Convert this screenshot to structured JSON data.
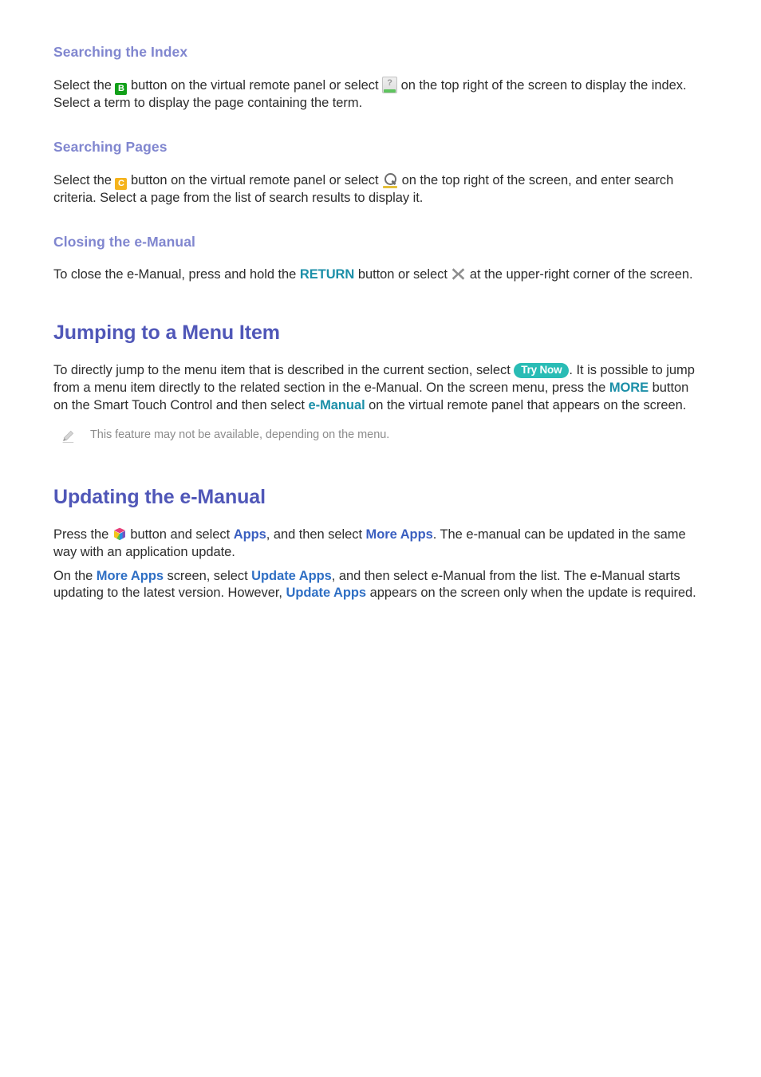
{
  "document": {
    "title": "e-Manual help page"
  },
  "sections": [
    {
      "id": "searching-the-index",
      "level": "h3",
      "heading": "Searching the Index",
      "paragraph_parts": [
        "Select the ",
        "[icon:color-button-b]",
        " button on the virtual remote panel or select ",
        "[icon:index]",
        " on the top right of the screen to display the index. Select a term to display the page containing the term."
      ],
      "text_1": "Select the ",
      "text_2": " button on the virtual remote panel or select ",
      "text_3": " on the top right of the screen to display the index. Select a term to display the page containing the term."
    },
    {
      "id": "searching-pages",
      "level": "h3",
      "heading": "Searching Pages",
      "text_1": "Select the ",
      "text_2": " button on the virtual remote panel or select ",
      "text_3": " on the top right of the screen, and enter search criteria. Select a page from the list of search results to display it."
    },
    {
      "id": "closing-the-e-manual",
      "level": "h3",
      "heading": "Closing the e-Manual",
      "text_1": "To close the e-Manual, press and hold the ",
      "link_return": "RETURN",
      "text_2": " button or select ",
      "text_3": " at the upper-right corner of the screen."
    },
    {
      "id": "jumping-to-a-menu-item",
      "level": "h2",
      "heading": "Jumping to a Menu Item",
      "text_1": "To directly jump to the menu item that is described in the current section, select ",
      "badge_try_now": "Try Now",
      "text_2": ". It is possible to jump from a menu item directly to the related section in the e-Manual. On the screen menu, press the ",
      "link_more": "MORE",
      "text_3": " button on the Smart Touch Control and then select ",
      "link_emanual": "e-Manual",
      "text_4": " on the virtual remote panel that appears on the screen.",
      "note": "This feature may not be available, depending on the menu."
    },
    {
      "id": "updating-the-e-manual",
      "level": "h2",
      "heading": "Updating the e-Manual",
      "p1_text_1": "Press the ",
      "p1_text_2": " button and select ",
      "p1_link_apps": "Apps",
      "p1_text_3": ", and then select ",
      "p1_link_more_apps": "More Apps",
      "p1_text_4": ". The e-manual can be updated in the same way with an application update.",
      "p2_text_1": "On the ",
      "p2_link_more_apps": "More Apps",
      "p2_text_2": " screen, select ",
      "p2_link_update_apps": "Update Apps",
      "p2_text_3": ", and then select e-Manual from the list. The e-Manual starts updating to the latest version. However, ",
      "p2_link_update_apps_2": "Update Apps",
      "p2_text_4": " appears on the screen only when the update is required."
    }
  ],
  "icons": {
    "color_button_b": "B",
    "color_button_c": "C",
    "index_icon": "?",
    "search_icon": "search-icon",
    "close_icon": "close-icon",
    "apps_icon": "smart-hub-apps-icon",
    "note_icon": "pencil-note-icon"
  },
  "colors": {
    "heading_h2": "#5057b8",
    "heading_h3": "#8086cf",
    "body_text": "#2d2d2d",
    "link_teal": "#1b8fa8",
    "link_blue": "#2f6fc4",
    "link_indigo": "#3a5fc0",
    "badge_try_now_bg": "#29bcb5",
    "button_b_bg": "#12a019",
    "button_c_bg": "#f5b31c",
    "note_text": "#8c8c8c"
  }
}
